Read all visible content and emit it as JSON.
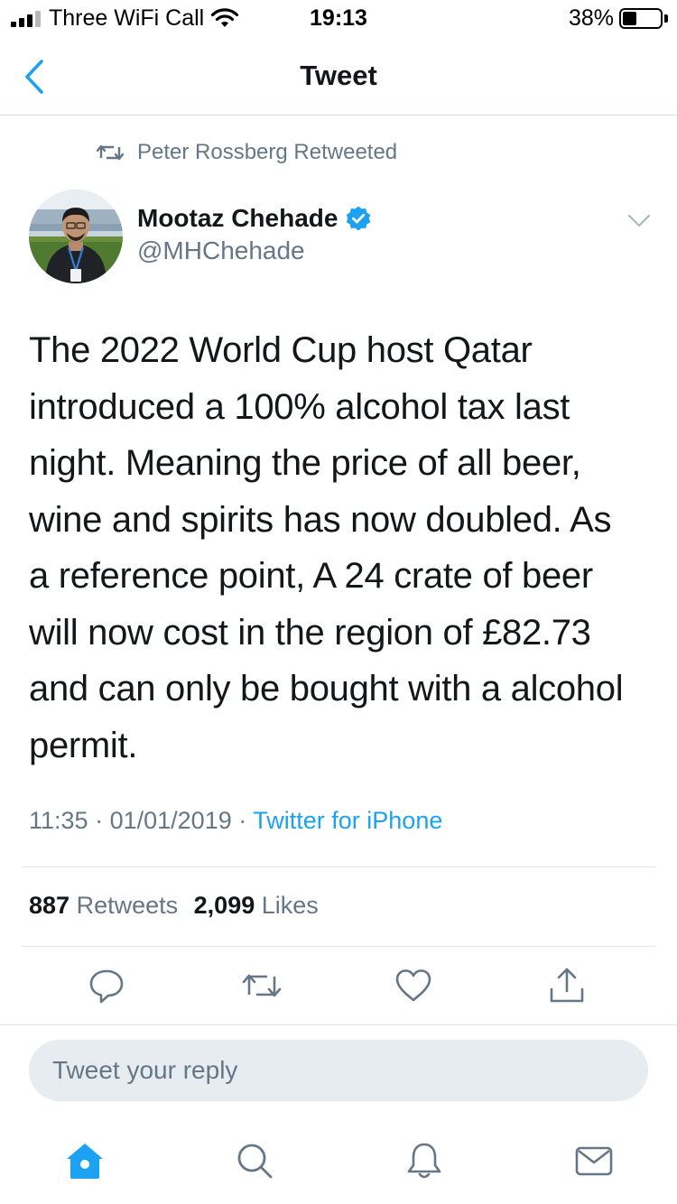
{
  "status_bar": {
    "carrier": "Three WiFi Call",
    "time": "19:13",
    "battery_percent": "38%",
    "battery_level": 0.38,
    "signal_bars": 3
  },
  "nav": {
    "title": "Tweet",
    "back_icon": "chevron-left-icon"
  },
  "retweet": {
    "icon": "retweet-icon",
    "text": "Peter Rossberg Retweeted"
  },
  "author": {
    "name": "Mootaz Chehade",
    "handle": "@MHChehade",
    "verified": true
  },
  "tweet": {
    "lines": [
      "The 2022 World Cup host Qatar",
      "introduced a 100% alcohol tax last",
      "night. Meaning the price of all beer,",
      "wine and spirits has now doubled. As",
      "a reference point, A 24 crate of beer",
      "will now cost in the region of £82.73",
      "and can only be bought with a alcohol",
      "permit."
    ],
    "time": "11:35",
    "separator": "·",
    "date": "01/01/2019",
    "source": "Twitter for iPhone"
  },
  "stats": {
    "retweets_count": "887",
    "retweets_label": "Retweets",
    "likes_count": "2,099",
    "likes_label": "Likes"
  },
  "actions": [
    "reply-icon",
    "retweet-icon",
    "like-icon",
    "share-icon"
  ],
  "reply": {
    "placeholder": "Tweet your reply"
  },
  "tabs": [
    "home-icon",
    "search-icon",
    "notifications-icon",
    "messages-icon"
  ],
  "colors": {
    "accent": "#1da1f2",
    "secondary_text": "#657786",
    "action_icon": "#657786",
    "primary_text": "#14171a",
    "divider": "#e1e8ed"
  }
}
